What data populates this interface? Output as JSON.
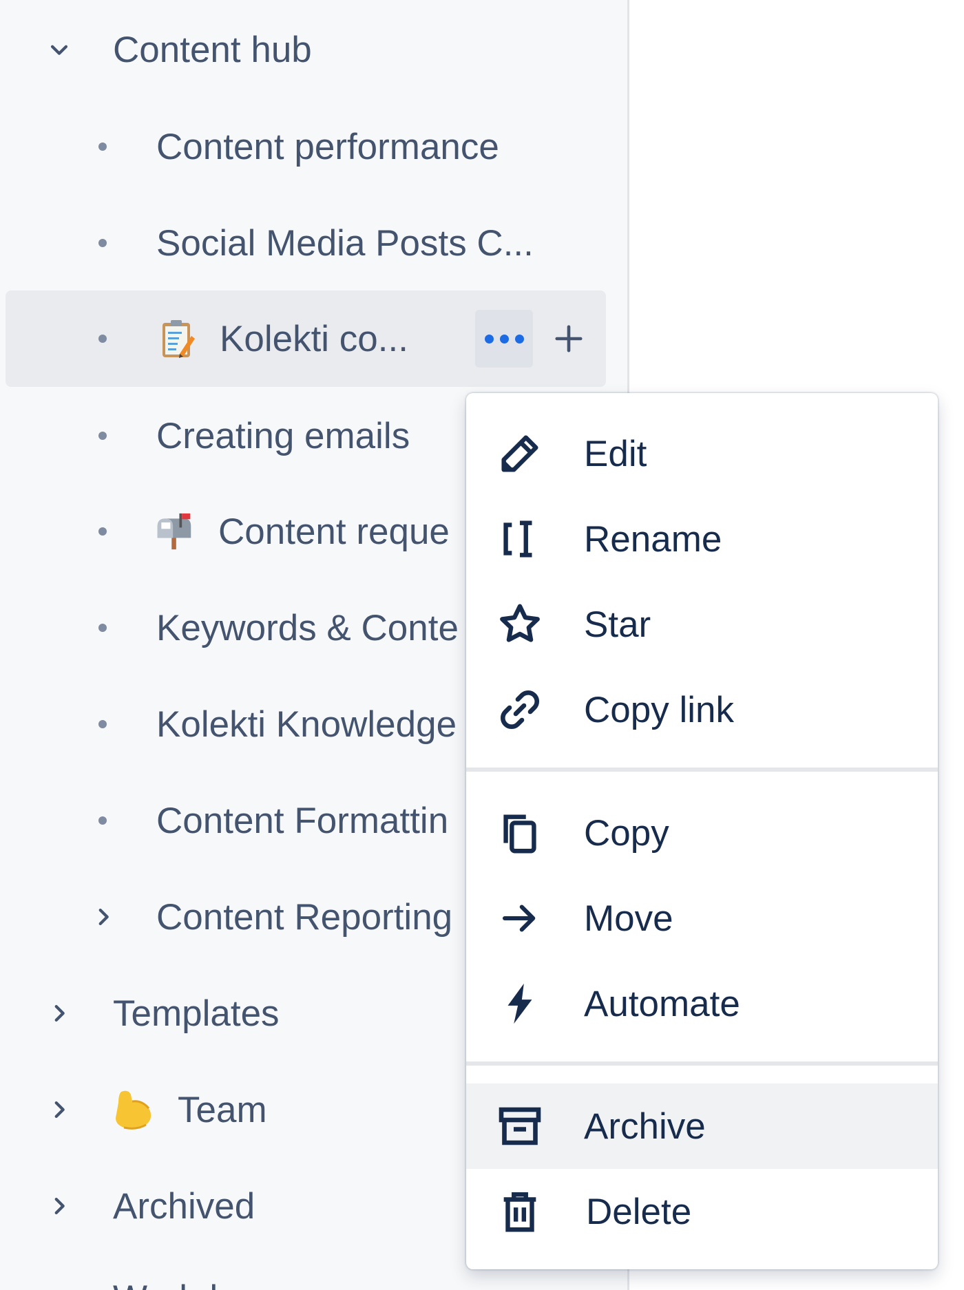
{
  "sidebar": {
    "section_title": "Content hub",
    "pages": [
      {
        "label": "Content performance"
      },
      {
        "label": "Social Media Posts C..."
      },
      {
        "label": "Kolekti co...",
        "emoji": "clipboard-icon"
      },
      {
        "label": "Creating emails"
      },
      {
        "label": "Content reque",
        "emoji": "mailbox-icon"
      },
      {
        "label": "Keywords & Conte"
      },
      {
        "label": "Kolekti Knowledge"
      },
      {
        "label": "Content Formattin"
      },
      {
        "label": "Content Reporting"
      }
    ],
    "sections": [
      {
        "label": "Templates"
      },
      {
        "label": "Team",
        "emoji": "flexed-biceps-icon"
      },
      {
        "label": "Archived"
      },
      {
        "label": "Workd"
      }
    ]
  },
  "context_menu": {
    "items": [
      {
        "label": "Edit",
        "icon": "pencil-icon"
      },
      {
        "label": "Rename",
        "icon": "rename-cursor-icon"
      },
      {
        "label": "Star",
        "icon": "star-icon"
      },
      {
        "label": "Copy link",
        "icon": "link-icon"
      },
      {
        "label": "Copy",
        "icon": "copy-icon"
      },
      {
        "label": "Move",
        "icon": "arrow-right-icon"
      },
      {
        "label": "Automate",
        "icon": "lightning-icon"
      },
      {
        "label": "Archive",
        "icon": "archive-box-icon"
      },
      {
        "label": "Delete",
        "icon": "trash-icon"
      }
    ]
  },
  "colors": {
    "text": "#44546f",
    "menu_text": "#172b4d",
    "accent": "#1d6ae5",
    "selected_row": "#e9ebee",
    "sidebar_bg": "#f7f8f9"
  }
}
